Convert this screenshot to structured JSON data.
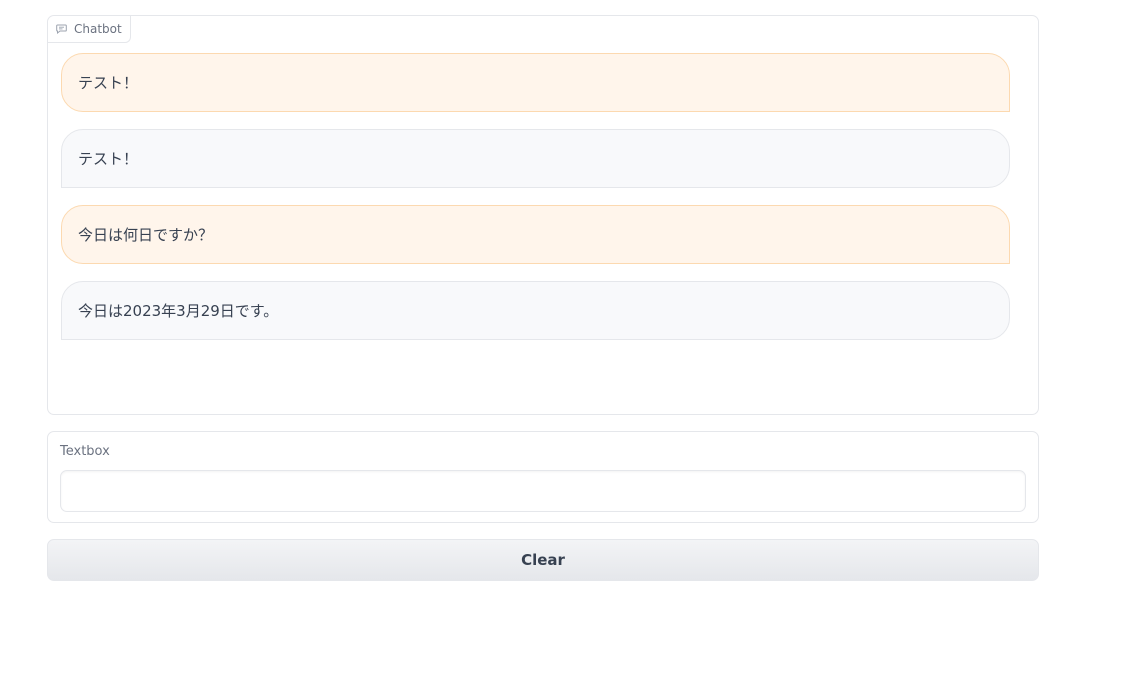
{
  "chatbot": {
    "label": "Chatbot",
    "icon": "chat-icon",
    "messages": [
      {
        "role": "user",
        "text": "テスト！"
      },
      {
        "role": "bot",
        "text": "テスト！"
      },
      {
        "role": "user",
        "text": "今日は何日ですか？"
      },
      {
        "role": "bot",
        "text": "今日は2023年3月29日です。"
      }
    ]
  },
  "textbox": {
    "label": "Textbox",
    "value": "",
    "placeholder": ""
  },
  "clear_button": {
    "label": "Clear"
  },
  "colors": {
    "user_bubble": "#fff5eb",
    "user_border": "#fcd9b0",
    "bot_bubble": "#f8f9fb",
    "border": "#e5e7eb"
  }
}
